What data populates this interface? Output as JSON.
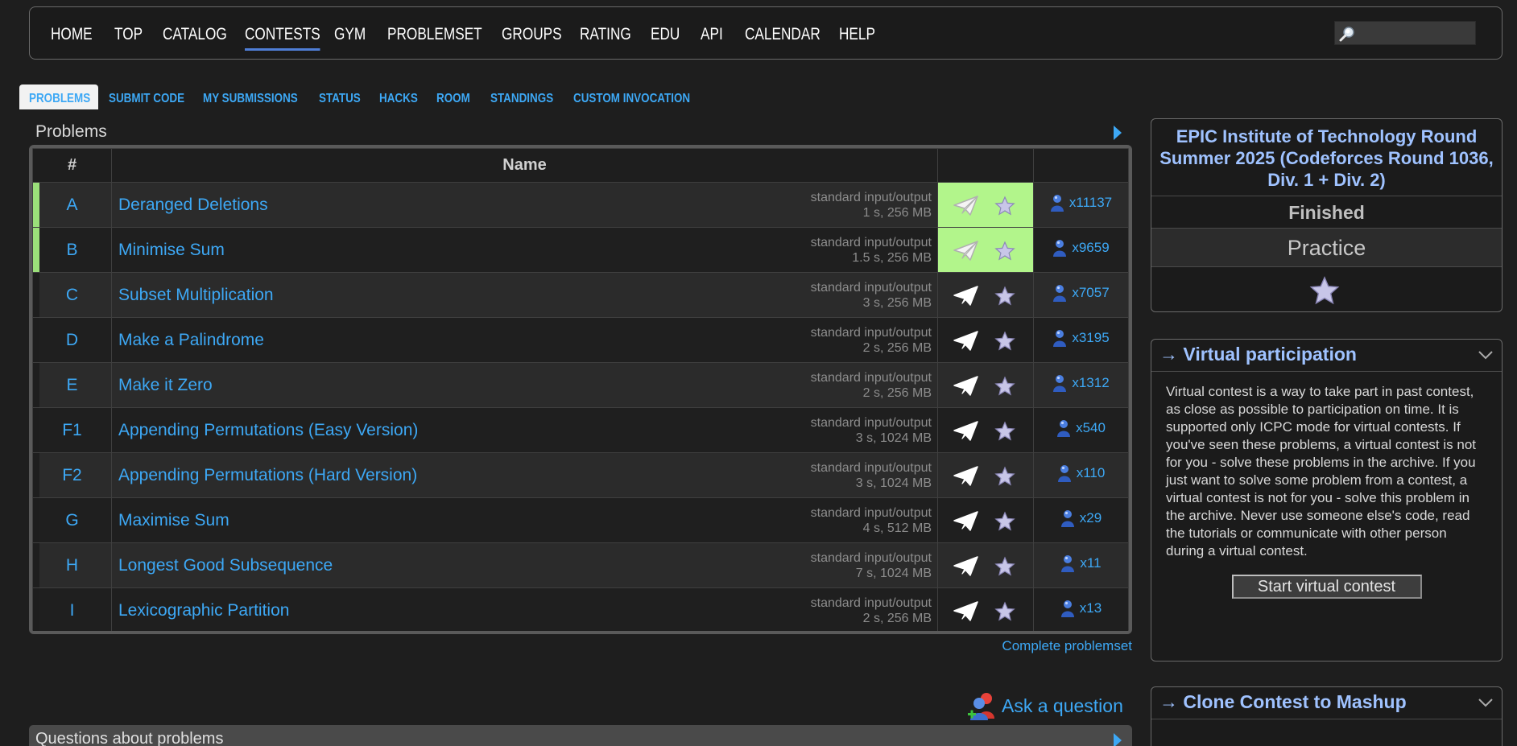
{
  "top_menu": {
    "items": [
      "HOME",
      "TOP",
      "CATALOG",
      "CONTESTS",
      "GYM",
      "PROBLEMSET",
      "GROUPS",
      "RATING",
      "EDU",
      "API",
      "CALENDAR",
      "HELP"
    ],
    "active": "CONTESTS",
    "search_placeholder": ""
  },
  "second_menu": {
    "items": [
      "PROBLEMS",
      "SUBMIT CODE",
      "MY SUBMISSIONS",
      "STATUS",
      "HACKS",
      "ROOM",
      "STANDINGS",
      "CUSTOM INVOCATION"
    ],
    "active": "PROBLEMS"
  },
  "problems": {
    "title": "Problems",
    "columns": [
      "#",
      "Name",
      "",
      ""
    ],
    "rows": [
      {
        "index": "A",
        "name": "Deranged Deletions",
        "io": "standard input/output",
        "limits": "1 s, 256 MB",
        "solved_count": "x11137",
        "accepted": true
      },
      {
        "index": "B",
        "name": "Minimise Sum",
        "io": "standard input/output",
        "limits": "1.5 s, 256 MB",
        "solved_count": "x9659",
        "accepted": true
      },
      {
        "index": "C",
        "name": "Subset Multiplication",
        "io": "standard input/output",
        "limits": "3 s, 256 MB",
        "solved_count": "x7057",
        "accepted": false
      },
      {
        "index": "D",
        "name": "Make a Palindrome",
        "io": "standard input/output",
        "limits": "2 s, 256 MB",
        "solved_count": "x3195",
        "accepted": false
      },
      {
        "index": "E",
        "name": "Make it Zero",
        "io": "standard input/output",
        "limits": "2 s, 256 MB",
        "solved_count": "x1312",
        "accepted": false
      },
      {
        "index": "F1",
        "name": "Appending Permutations (Easy Version)",
        "io": "standard input/output",
        "limits": "3 s, 1024 MB",
        "solved_count": "x540",
        "accepted": false
      },
      {
        "index": "F2",
        "name": "Appending Permutations (Hard Version)",
        "io": "standard input/output",
        "limits": "3 s, 1024 MB",
        "solved_count": "x110",
        "accepted": false
      },
      {
        "index": "G",
        "name": "Maximise Sum",
        "io": "standard input/output",
        "limits": "4 s, 512 MB",
        "solved_count": "x29",
        "accepted": false
      },
      {
        "index": "H",
        "name": "Longest Good Subsequence",
        "io": "standard input/output",
        "limits": "7 s, 1024 MB",
        "solved_count": "x11",
        "accepted": false
      },
      {
        "index": "I",
        "name": "Lexicographic Partition",
        "io": "standard input/output",
        "limits": "2 s, 256 MB",
        "solved_count": "x13",
        "accepted": false
      }
    ],
    "complete_link": "Complete problemset",
    "ask_question": "Ask a question",
    "questions_title": "Questions about problems"
  },
  "sidebar": {
    "contest_name": "EPIC Institute of Technology Round Summer 2025 (Codeforces Round 1036, Div. 1 + Div. 2)",
    "status": "Finished",
    "phase": "Practice",
    "virtual": {
      "title": "→ Virtual participation",
      "text": "Virtual contest is a way to take part in past contest, as close as possible to participation on time. It is supported only ICPC mode for virtual contests. If you've seen these problems, a virtual contest is not for you - solve these problems in the archive. If you just want to solve some problem from a contest, a virtual contest is not for you - solve this problem in the archive. Never use someone else's code, read the tutorials or communicate with other person during a virtual contest.",
      "button": "Start virtual contest"
    },
    "clone": {
      "title": "→ Clone Contest to Mashup"
    }
  },
  "colors": {
    "link": "#3da8f5",
    "accepted": "#b2f58b",
    "sidebar_title": "#9fc2ff",
    "background": "#1e1e1e"
  }
}
